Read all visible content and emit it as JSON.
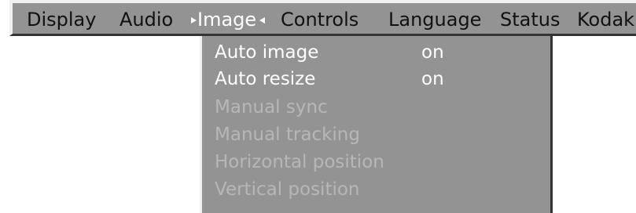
{
  "menubar": {
    "items": [
      {
        "label": "Display"
      },
      {
        "label": "Audio"
      },
      {
        "label": "Image"
      },
      {
        "label": "Controls"
      },
      {
        "label": "Language"
      },
      {
        "label": "Status"
      },
      {
        "label": "Kodak"
      }
    ],
    "active_index": 2
  },
  "dropdown": {
    "items": [
      {
        "label": "Auto image",
        "value": "on",
        "enabled": true
      },
      {
        "label": "Auto resize",
        "value": "on",
        "enabled": true
      },
      {
        "label": "Manual sync",
        "value": "",
        "enabled": false
      },
      {
        "label": "Manual tracking",
        "value": "",
        "enabled": false
      },
      {
        "label": "Horizontal position",
        "value": "",
        "enabled": false
      },
      {
        "label": "Vertical position",
        "value": "",
        "enabled": false
      }
    ]
  },
  "colors": {
    "panel": "#939393",
    "highlight": "#f0f0f0",
    "shadow": "#343434",
    "text_enabled": "#ffffff",
    "text_disabled": "#b7b7b7",
    "text_menu": "#111111"
  },
  "icons": {
    "active_left_marker": "triangle-right-icon",
    "active_right_marker": "triangle-left-icon"
  }
}
